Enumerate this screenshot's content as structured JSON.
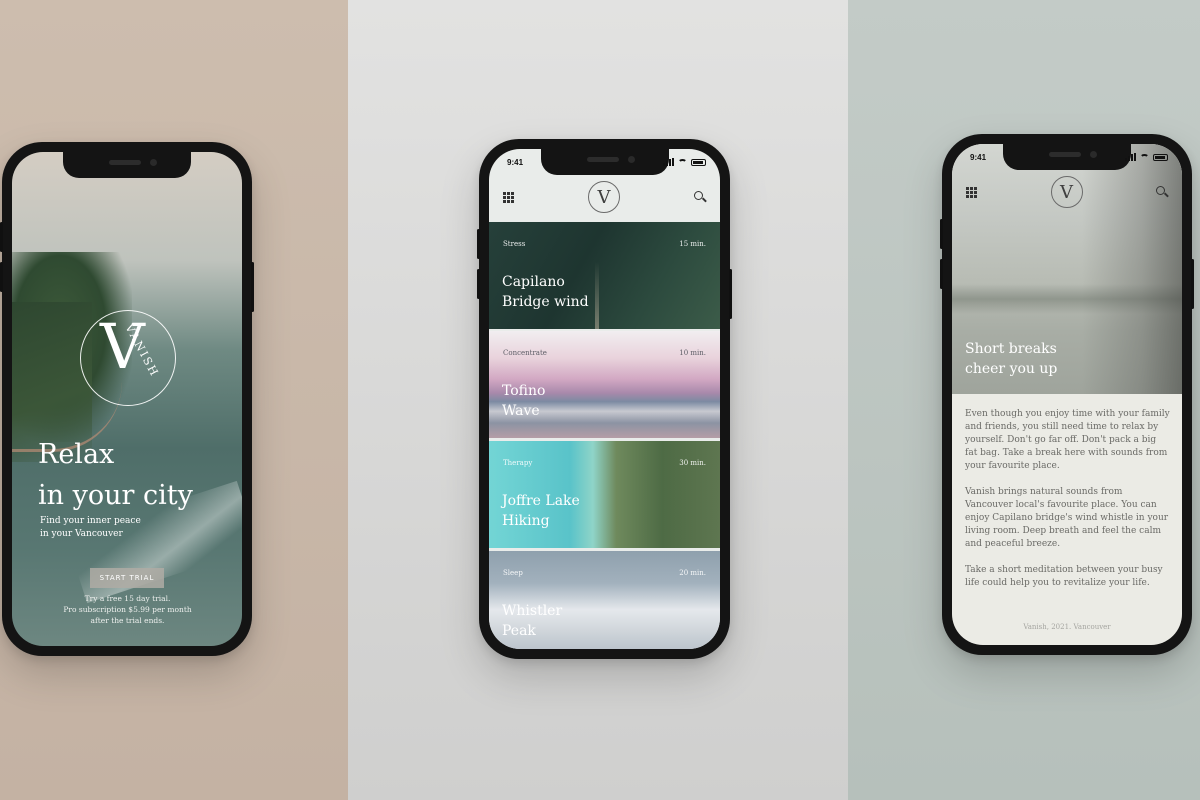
{
  "screens": {
    "welcome": {
      "brand_mark": "V",
      "brand_word": "VANISH",
      "title_line1": "Relax",
      "title_line2": "in your city",
      "subtitle_line1": "Find your inner peace",
      "subtitle_line2": "in your Vancouver",
      "cta_label": "START TRIAL",
      "trial_line1": "Try a free 15 day trial.",
      "trial_line2": "Pro subscription $5.99 per month",
      "trial_line3": "after the trial ends."
    },
    "list": {
      "status_time": "9:41",
      "logo_mark": "V",
      "cards": [
        {
          "category": "Stress",
          "duration": "15 min.",
          "name_line1": "Capilano",
          "name_line2": "Bridge wind"
        },
        {
          "category": "Concentrate",
          "duration": "10 min.",
          "name_line1": "Tofino",
          "name_line2": "Wave"
        },
        {
          "category": "Therapy",
          "duration": "30 min.",
          "name_line1": "Joffre Lake",
          "name_line2": "Hiking"
        },
        {
          "category": "Sleep",
          "duration": "20 min.",
          "name_line1": "Whistler",
          "name_line2": "Peak"
        }
      ]
    },
    "detail": {
      "status_time": "9:41",
      "logo_mark": "V",
      "hero_line1": "Short breaks",
      "hero_line2": "cheer you up",
      "paragraphs": [
        "Even though you enjoy time with your family and friends, you still need time to relax by yourself. Don't go far off. Don't pack a big fat bag. Take a break here with sounds from your favourite place.",
        "Vanish brings natural sounds from Vancouver local's favourite place. You can enjoy Capilano bridge's wind whistle in your living room. Deep breath and feel the calm and peaceful breeze.",
        "Take a short meditation between your busy life could help you to revitalize your life."
      ],
      "footer": "Vanish, 2021. Vancouver"
    }
  }
}
